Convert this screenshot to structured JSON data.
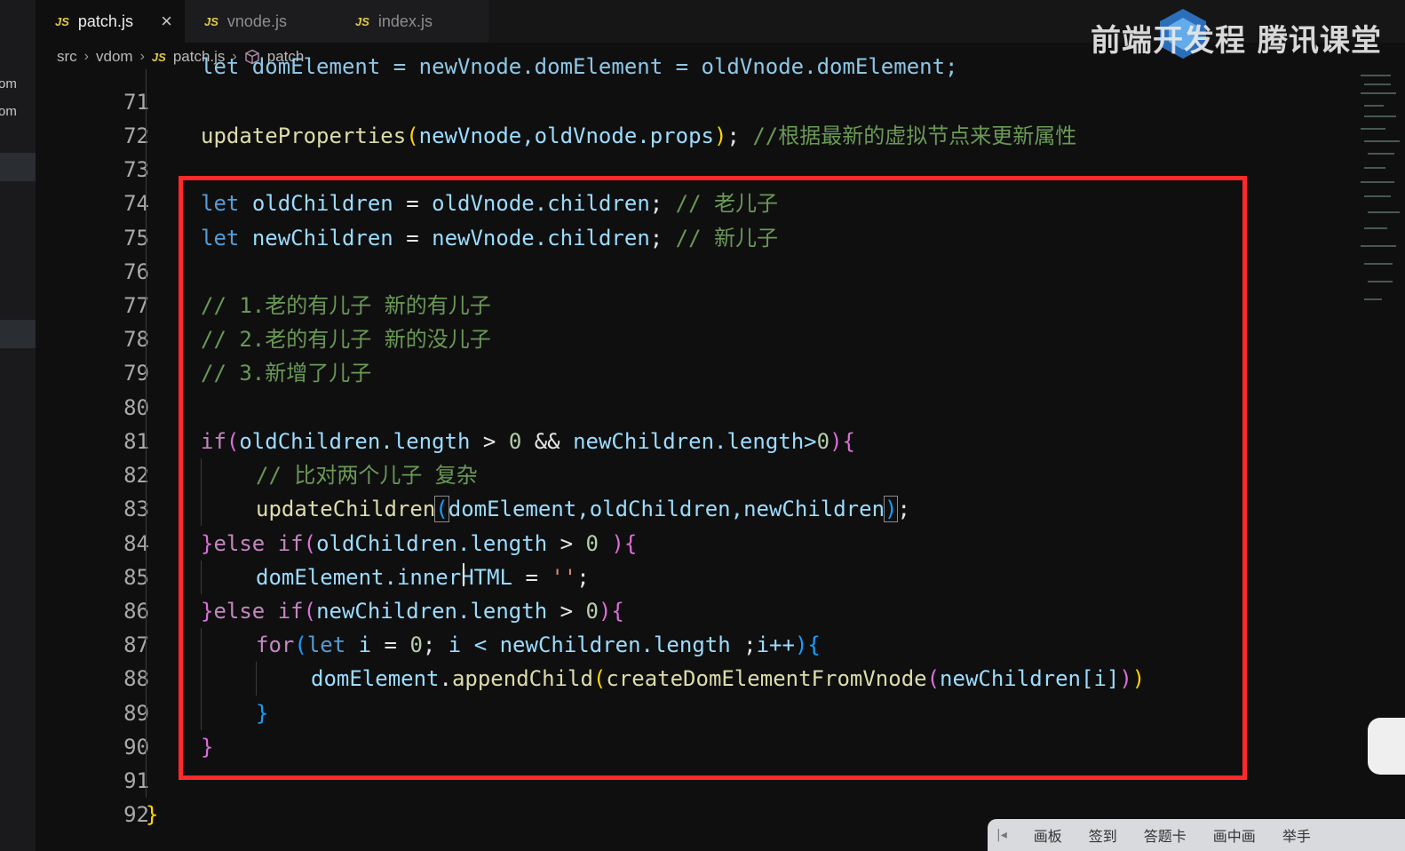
{
  "sidebar": {
    "fragments": [
      "om",
      "om"
    ]
  },
  "tabs": [
    {
      "badge": "JS",
      "label": "patch.js",
      "close": "×"
    },
    {
      "badge": "JS",
      "label": "vnode.js"
    },
    {
      "badge": "JS",
      "label": "index.js"
    }
  ],
  "breadcrumb": {
    "src": "src",
    "vdom": "vdom",
    "file_badge": "JS",
    "file": "patch.js",
    "symbol": "patch"
  },
  "watermark": {
    "text": "前端开发程 腾讯课堂"
  },
  "editor": {
    "partial_top_line": "let domElement = newVnode.domElement = oldVnode.domElement;",
    "line_numbers": [
      "71",
      "72",
      "73",
      "74",
      "75",
      "76",
      "77",
      "78",
      "79",
      "80",
      "81",
      "82",
      "83",
      "84",
      "85",
      "86",
      "87",
      "88",
      "89",
      "90",
      "91",
      "92"
    ],
    "lines": {
      "l72": {
        "fn": "updateProperties",
        "args": "newVnode,oldVnode.props",
        "comment": "//根据最新的虚拟节点来更新属性"
      },
      "l74": {
        "kw": "let",
        "name": "oldChildren",
        "value": "oldVnode.children",
        "comment": "// 老儿子"
      },
      "l75": {
        "kw": "let",
        "name": "newChildren",
        "value": "newVnode.children",
        "comment": "// 新儿子"
      },
      "l77": "// 1.老的有儿子 新的有儿子",
      "l78": "// 2.老的有儿子 新的没儿子",
      "l79": "// 3.新增了儿子",
      "l81": {
        "kw": "if",
        "lhs": "oldChildren.length",
        "op1": ">",
        "n1": "0",
        "and": "&&",
        "rhs": "newChildren.length>",
        "n2": "0"
      },
      "l82": "// 比对两个儿子 复杂",
      "l83": {
        "fn": "updateChildren",
        "args": "domElement,oldChildren,newChildren"
      },
      "l84": {
        "else": "else",
        "kw": "if",
        "cond": "oldChildren.length",
        "op": ">",
        "n": "0"
      },
      "l85": {
        "target": "domElement.innerHTML",
        "op": "=",
        "str": "''"
      },
      "l86": {
        "else": "else",
        "kw": "if",
        "cond": "newChildren.length",
        "op": ">",
        "n": "0"
      },
      "l87": {
        "kw": "for",
        "let": "let",
        "i": "i",
        "eq": "=",
        "n": "0",
        "cond": "i < newChildren.length",
        "inc": "i++"
      },
      "l88": {
        "obj": "domElement",
        "method": "appendChild",
        "inner_fn": "createDomElementFromVnode",
        "arg": "newChildren[i]"
      },
      "l89": "}",
      "l90": "}",
      "l92": "}"
    }
  },
  "bottom_toolbar": {
    "handle": "|◂",
    "items": [
      "画板",
      "签到",
      "答题卡",
      "画中画",
      "举手"
    ]
  },
  "colors": {
    "highlight_box": "#ff2a2a",
    "keyword": "#569cd6",
    "comment": "#6a9955",
    "function": "#dcdcaa",
    "variable": "#9cdcfe"
  }
}
